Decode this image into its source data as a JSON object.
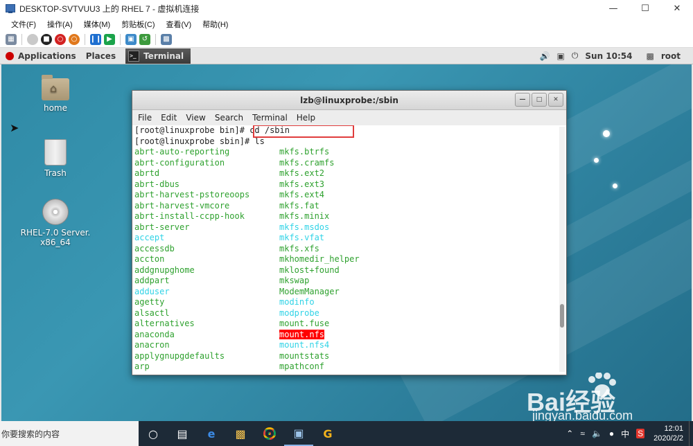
{
  "host": {
    "title": "DESKTOP-SVTVUU3 上的 RHEL 7 - 虚拟机连接",
    "menu": [
      "文件(F)",
      "操作(A)",
      "媒体(M)",
      "剪贴板(C)",
      "查看(V)",
      "帮助(H)"
    ],
    "toolbar_icons": [
      "ctrl-alt-del-icon",
      "start-icon",
      "stop-icon",
      "shutdown-icon",
      "save-state-icon",
      "pause-icon",
      "resume-icon",
      "checkpoint-icon",
      "revert-icon",
      "enhanced-session-icon"
    ]
  },
  "gnome": {
    "applications": "Applications",
    "places": "Places",
    "terminal_tab": "Terminal",
    "clock": "Sun 10:54",
    "user": "root"
  },
  "desktop": {
    "icons": [
      {
        "label": "home"
      },
      {
        "label": "Trash"
      },
      {
        "label_line1": "RHEL-7.0 Server.",
        "label_line2": "x86_64"
      }
    ]
  },
  "terminal": {
    "title": "lzb@linuxprobe:/sbin",
    "menu": [
      "File",
      "Edit",
      "View",
      "Search",
      "Terminal",
      "Help"
    ],
    "prompt1": "[root@linuxprobe bin]# ",
    "cmd1": "cd /sbin",
    "prompt2": "[root@linuxprobe sbin]# ",
    "cmd2": "ls",
    "left_col": [
      {
        "name": "abrt-auto-reporting",
        "color": "green"
      },
      {
        "name": "abrt-configuration",
        "color": "green"
      },
      {
        "name": "abrtd",
        "color": "green"
      },
      {
        "name": "abrt-dbus",
        "color": "green"
      },
      {
        "name": "abrt-harvest-pstoreoops",
        "color": "green"
      },
      {
        "name": "abrt-harvest-vmcore",
        "color": "green"
      },
      {
        "name": "abrt-install-ccpp-hook",
        "color": "green"
      },
      {
        "name": "abrt-server",
        "color": "green"
      },
      {
        "name": "accept",
        "color": "cyan"
      },
      {
        "name": "accessdb",
        "color": "green"
      },
      {
        "name": "accton",
        "color": "green"
      },
      {
        "name": "addgnupghome",
        "color": "green"
      },
      {
        "name": "addpart",
        "color": "green"
      },
      {
        "name": "adduser",
        "color": "cyan"
      },
      {
        "name": "agetty",
        "color": "green"
      },
      {
        "name": "alsactl",
        "color": "green"
      },
      {
        "name": "alternatives",
        "color": "green"
      },
      {
        "name": "anaconda",
        "color": "green"
      },
      {
        "name": "anacron",
        "color": "green"
      },
      {
        "name": "applygnupgdefaults",
        "color": "green"
      },
      {
        "name": "arp",
        "color": "green"
      }
    ],
    "right_col": [
      {
        "name": "mkfs.btrfs",
        "color": "green"
      },
      {
        "name": "mkfs.cramfs",
        "color": "green"
      },
      {
        "name": "mkfs.ext2",
        "color": "green"
      },
      {
        "name": "mkfs.ext3",
        "color": "green"
      },
      {
        "name": "mkfs.ext4",
        "color": "green"
      },
      {
        "name": "mkfs.fat",
        "color": "green"
      },
      {
        "name": "mkfs.minix",
        "color": "green"
      },
      {
        "name": "mkfs.msdos",
        "color": "cyan"
      },
      {
        "name": "mkfs.vfat",
        "color": "cyan"
      },
      {
        "name": "mkfs.xfs",
        "color": "green"
      },
      {
        "name": "mkhomedir_helper",
        "color": "green"
      },
      {
        "name": "mklost+found",
        "color": "green"
      },
      {
        "name": "mkswap",
        "color": "green"
      },
      {
        "name": "ModemManager",
        "color": "green"
      },
      {
        "name": "modinfo",
        "color": "cyan"
      },
      {
        "name": "modprobe",
        "color": "cyan"
      },
      {
        "name": "mount.fuse",
        "color": "green"
      },
      {
        "name": "mount.nfs",
        "color": "sel"
      },
      {
        "name": "mount.nfs4",
        "color": "cyan"
      },
      {
        "name": "mountstats",
        "color": "green"
      },
      {
        "name": "mpathconf",
        "color": "green"
      }
    ],
    "scroll_position": 0.8
  },
  "taskbar": {
    "search_placeholder": "你要搜索的内容",
    "time": "12:01",
    "date": "2020/2/2",
    "ime": "中",
    "icons": [
      "cortana-icon",
      "task-view-icon",
      "edge-icon",
      "file-explorer-icon",
      "chrome-icon",
      "hyperv-icon",
      "app-g-icon"
    ]
  },
  "watermark": {
    "brand": "Bai经验",
    "url": "jingyan.baidu.com"
  },
  "colors": {
    "ls_green": "#2ea12e",
    "ls_cyan": "#2fd3e6",
    "highlight_red": "#ff0000",
    "annotation_red": "#e03c3c"
  }
}
